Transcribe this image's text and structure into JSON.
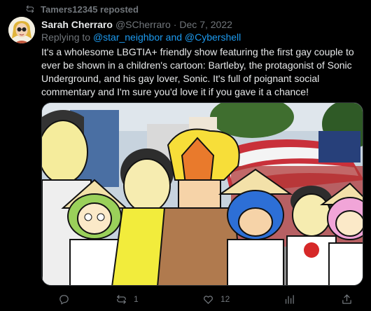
{
  "repost": {
    "label": "Tamers12345 reposted",
    "icon": "repost-icon"
  },
  "author": {
    "display_name": "Sarah Cherraro",
    "handle": "@SCherraro",
    "separator": "·",
    "date": "Dec 7, 2022"
  },
  "reply_to": {
    "prefix": "Replying to",
    "mention1": "@star_neighbor",
    "conjunction": "and",
    "mention2": "@Cybershell"
  },
  "tweet": {
    "text": "It's a wholesome LBGTIA+ friendly show featuring the first gay couple to ever be shown in a children's cartoon: Bartleby, the protagonist of Sonic Underground, and his gay lover, Sonic. It's full of poignant social commentary and I'm sure you'd love it if you gave it a chance!"
  },
  "actions": {
    "reply_count": "",
    "repost_count": "1",
    "like_count": "12",
    "stats_count": "",
    "share_count": ""
  },
  "colors": {
    "background": "#000000",
    "text": "#e7e9ea",
    "muted": "#71767b",
    "link": "#1d9bf0",
    "border": "#2f3336"
  }
}
